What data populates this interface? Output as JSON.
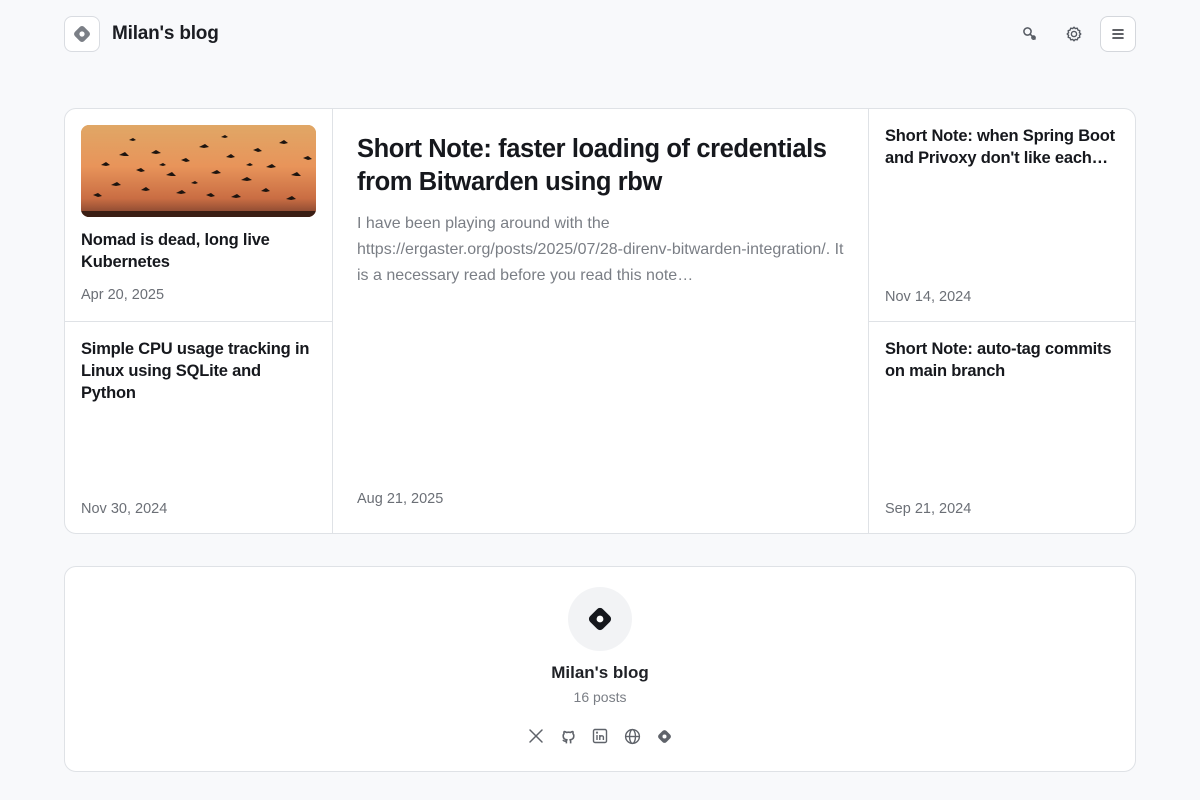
{
  "header": {
    "title": "Milan's blog",
    "actions": [
      "search-icon",
      "settings-icon",
      "menu-icon"
    ]
  },
  "posts": {
    "top_left": {
      "title": "Nomad is dead, long live Kubernetes",
      "date": "Apr 20, 2025",
      "has_image": true
    },
    "bottom_left": {
      "title": "Simple CPU usage tracking in Linux using SQLite and Python",
      "date": "Nov 30, 2024"
    },
    "featured": {
      "title": "Short Note: faster loading of credentials from Bitwarden using rbw",
      "excerpt": "I have been playing around with the https://ergaster.org/posts/2025/07/28-direnv-bitwarden-integration/. It is a necessary read before you read this note…",
      "date": "Aug 21, 2025"
    },
    "top_right": {
      "title": "Short Note: when Spring Boot and Privoxy don't like each…",
      "date": "Nov 14, 2024"
    },
    "bottom_right": {
      "title": "Short Note: auto-tag commits on main branch",
      "date": "Sep 21, 2024"
    }
  },
  "profile": {
    "name": "Milan's blog",
    "post_count": "16 posts",
    "socials": [
      "x-icon",
      "github-icon",
      "linkedin-icon",
      "globe-icon",
      "blog-icon"
    ]
  },
  "colors": {
    "background": "#f8f9fb",
    "border": "#dfe2e6",
    "text": "#16181d",
    "muted": "#6b6f76"
  }
}
